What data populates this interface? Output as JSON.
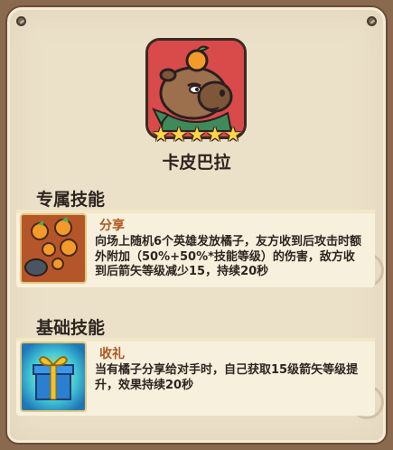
{
  "hero": {
    "name": "卡皮巴拉",
    "stars": 5,
    "portrait_icon": "capybara-with-tangerine-icon"
  },
  "sections": {
    "exclusive": {
      "title": "专属技能",
      "skill": {
        "name": "分享",
        "icon": "tangerines-icon",
        "description": "向场上随机6个英雄发放橘子，友方收到后攻击时额外附加（50%+50%*技能等级）的伤害，敌方收到后箭矢等级减少15，持续20秒"
      }
    },
    "basic": {
      "title": "基础技能",
      "skill": {
        "name": "收礼",
        "icon": "gift-box-icon",
        "description": "当有橘子分享给对手时，自己获取15级箭矢等级提升，效果持续20秒"
      }
    }
  },
  "colors": {
    "panel": "#ebe1c9",
    "border": "#6b4c35",
    "accent_skill_name": "#b4541e",
    "portrait_bg": "#d94a4a"
  }
}
